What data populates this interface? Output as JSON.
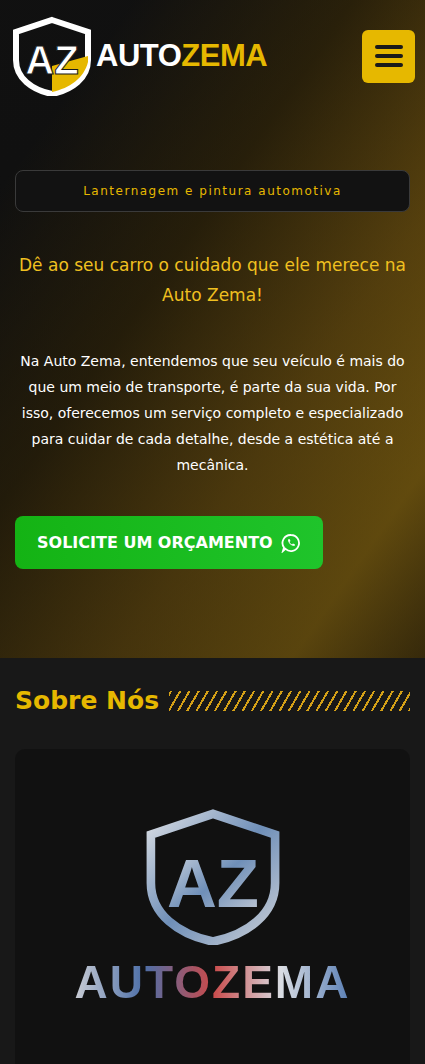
{
  "header": {
    "logo": {
      "mark": "AZ",
      "name_first": "AUTO",
      "name_second": "ZEMA"
    }
  },
  "hero": {
    "badge": "Lanternagem e pintura automotiva",
    "title": "Dê ao seu carro o cuidado que ele merece na Auto Zema!",
    "text": "Na Auto Zema, entendemos que seu veículo é mais do que um meio de transporte, é parte da sua vida. Por isso, oferecemos um serviço completo e especializado para cuidar de cada detalhe, desde a estética até a mecânica.",
    "cta": "SOLICITE UM ORÇAMENTO"
  },
  "about": {
    "title": "Sobre Nós",
    "logo": {
      "mark": "AZ",
      "name": "AUTOZEMA"
    }
  }
}
